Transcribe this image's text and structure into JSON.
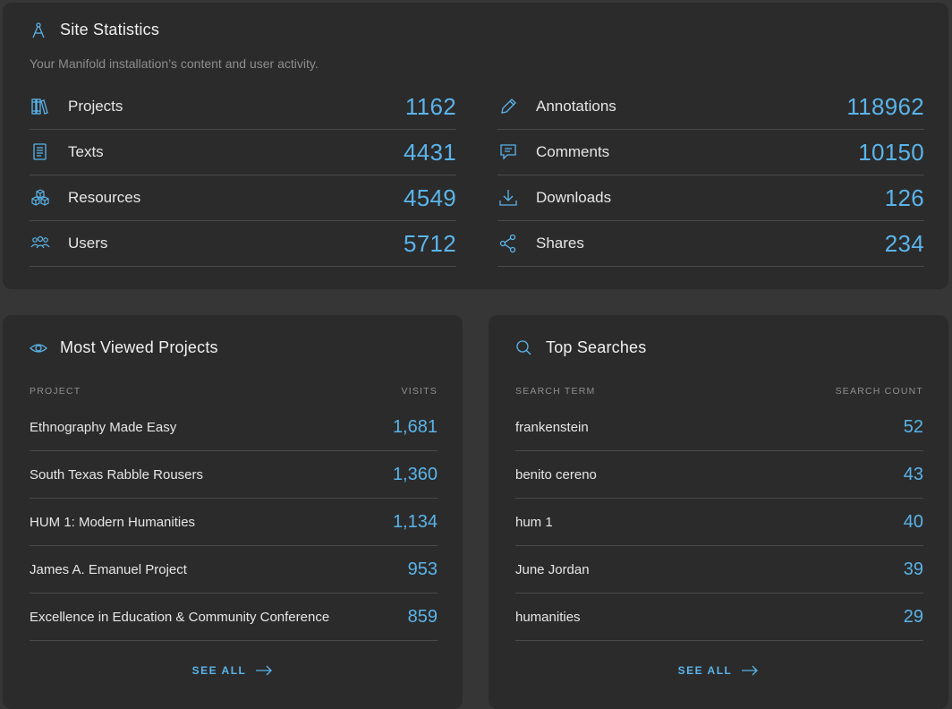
{
  "site_statistics": {
    "title": "Site Statistics",
    "subtitle": "Your Manifold installation’s content and user activity.",
    "left": [
      {
        "label": "Projects",
        "value": "1162",
        "icon": "books-icon"
      },
      {
        "label": "Texts",
        "value": "4431",
        "icon": "text-icon"
      },
      {
        "label": "Resources",
        "value": "4549",
        "icon": "cubes-icon"
      },
      {
        "label": "Users",
        "value": "5712",
        "icon": "users-icon"
      }
    ],
    "right": [
      {
        "label": "Annotations",
        "value": "118962",
        "icon": "pencil-icon"
      },
      {
        "label": "Comments",
        "value": "10150",
        "icon": "comment-icon"
      },
      {
        "label": "Downloads",
        "value": "126",
        "icon": "download-icon"
      },
      {
        "label": "Shares",
        "value": "234",
        "icon": "share-icon"
      }
    ]
  },
  "most_viewed": {
    "title": "Most Viewed Projects",
    "col_left": "PROJECT",
    "col_right": "VISITS",
    "rows": [
      {
        "name": "Ethnography Made Easy",
        "value": "1,681"
      },
      {
        "name": "South Texas Rabble Rousers",
        "value": "1,360"
      },
      {
        "name": "HUM 1: Modern Humanities",
        "value": "1,134"
      },
      {
        "name": "James A. Emanuel Project",
        "value": "953"
      },
      {
        "name": "Excellence in Education & Community Conference",
        "value": "859"
      }
    ],
    "see_all": "SEE ALL"
  },
  "top_searches": {
    "title": "Top Searches",
    "col_left": "SEARCH TERM",
    "col_right": "SEARCH COUNT",
    "rows": [
      {
        "name": "frankenstein",
        "value": "52"
      },
      {
        "name": "benito cereno",
        "value": "43"
      },
      {
        "name": "hum 1",
        "value": "40"
      },
      {
        "name": "June Jordan",
        "value": "39"
      },
      {
        "name": "humanities",
        "value": "29"
      }
    ],
    "see_all": "SEE ALL"
  },
  "colors": {
    "accent": "#5ab4ea",
    "panel": "#2b2b2b",
    "background": "#363636"
  }
}
